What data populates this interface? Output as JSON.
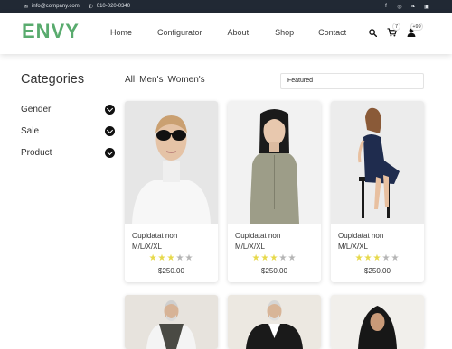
{
  "topbar": {
    "email": "info@company.com",
    "phone": "010-020-0340",
    "social_icons": [
      "facebook-icon",
      "instagram-icon",
      "twitter-icon",
      "linkedin-icon"
    ]
  },
  "brand": {
    "logo": "ENVY",
    "accent": "#59ab6e"
  },
  "nav": [
    "Home",
    "Configurator",
    "About",
    "Shop",
    "Contact"
  ],
  "header_icons": {
    "cart_count": "7",
    "user_count": "+99"
  },
  "sidebar": {
    "title": "Categories",
    "items": [
      {
        "label": "Gender"
      },
      {
        "label": "Sale"
      },
      {
        "label": "Product"
      }
    ]
  },
  "filters": [
    "All",
    "Men's",
    "Women's"
  ],
  "sort": {
    "selected": "Featured"
  },
  "products": [
    {
      "name": "Oupidatat non",
      "sizes": "M/L/X/XL",
      "rating": 3,
      "max_rating": 5,
      "price": "$250.00"
    },
    {
      "name": "Oupidatat non",
      "sizes": "M/L/X/XL",
      "rating": 3,
      "max_rating": 5,
      "price": "$250.00"
    },
    {
      "name": "Oupidatat non",
      "sizes": "M/L/X/XL",
      "rating": 3,
      "max_rating": 5,
      "price": "$250.00"
    }
  ],
  "colors": {
    "topbar_bg": "#212934",
    "star_on": "#e7d94b",
    "star_off": "#b5b5b5"
  }
}
